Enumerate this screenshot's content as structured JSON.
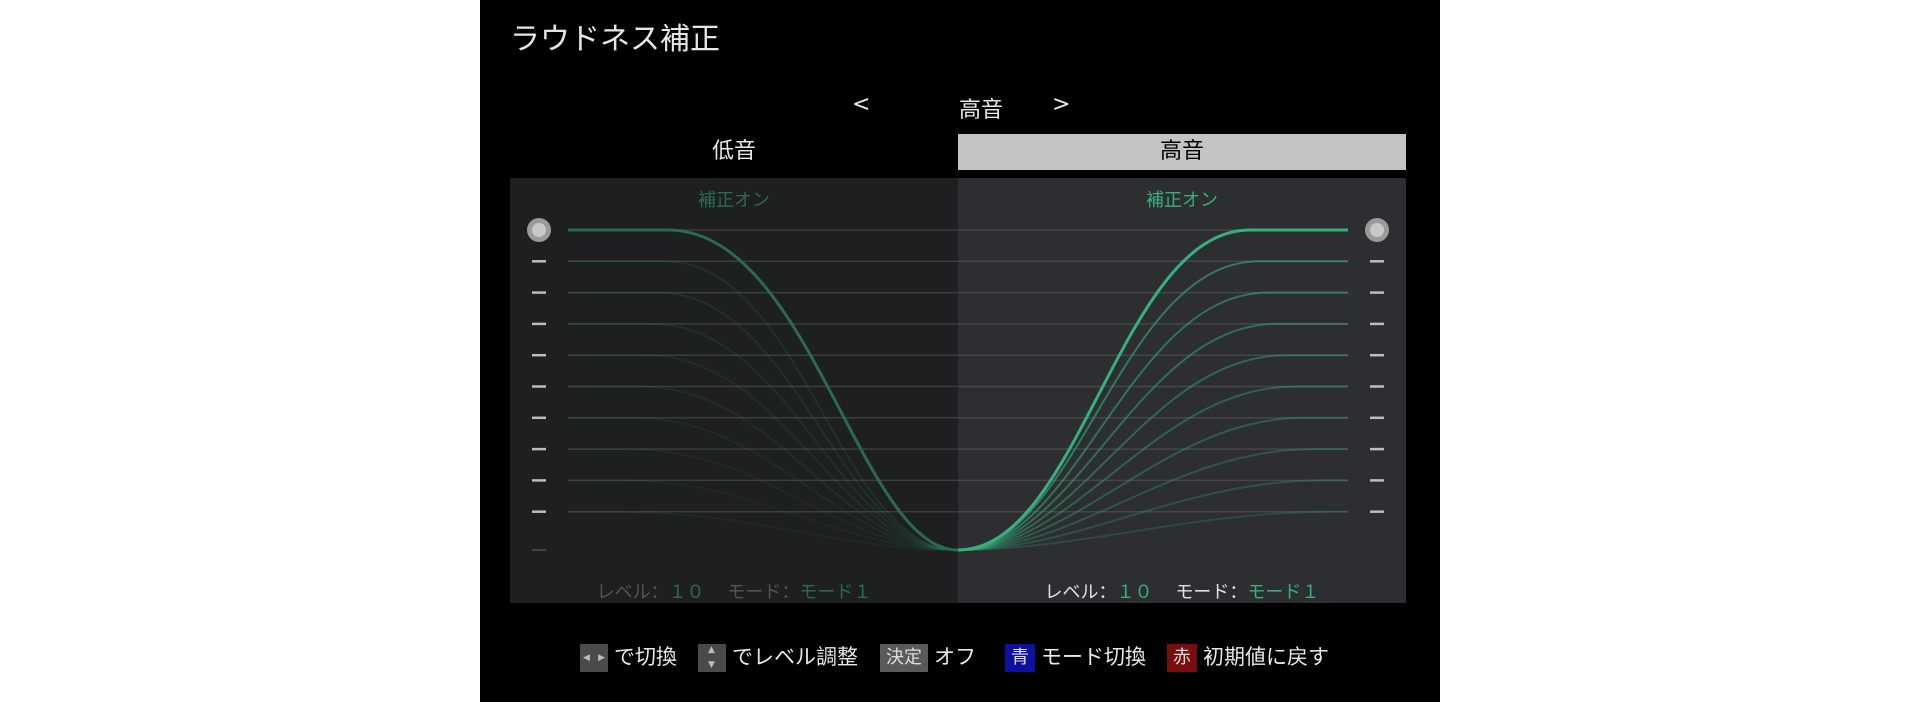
{
  "screen": {
    "title": "ラウドネス補正",
    "selector": {
      "prev": "<",
      "label": "高音",
      "next": ">"
    }
  },
  "tabs": [
    {
      "label": "低音",
      "selected": false
    },
    {
      "label": "高音",
      "selected": true
    }
  ],
  "panels": {
    "bass": {
      "status": "補正オン",
      "level_label": "レベル：",
      "level_value": "１０",
      "mode_label": "モード：",
      "mode_value": "モード１"
    },
    "treble": {
      "status": "補正オン",
      "level_label": "レベル：",
      "level_value": "１０",
      "mode_label": "モード：",
      "mode_value": "モード１"
    }
  },
  "slider": {
    "levels": 10,
    "current_level": 10
  },
  "guide": {
    "switch": "で切換",
    "adjust": "でレベル調整",
    "enter_key": "決定",
    "enter_action": "オフ",
    "blue_key": "青",
    "blue_action": "モード切換",
    "red_key": "赤",
    "red_action": "初期値に戻す"
  },
  "colors": {
    "accent": "#36b07d",
    "blue_key": "#1010a0",
    "red_key": "#7a0e0e",
    "enter_key": "#5a5a5a"
  }
}
